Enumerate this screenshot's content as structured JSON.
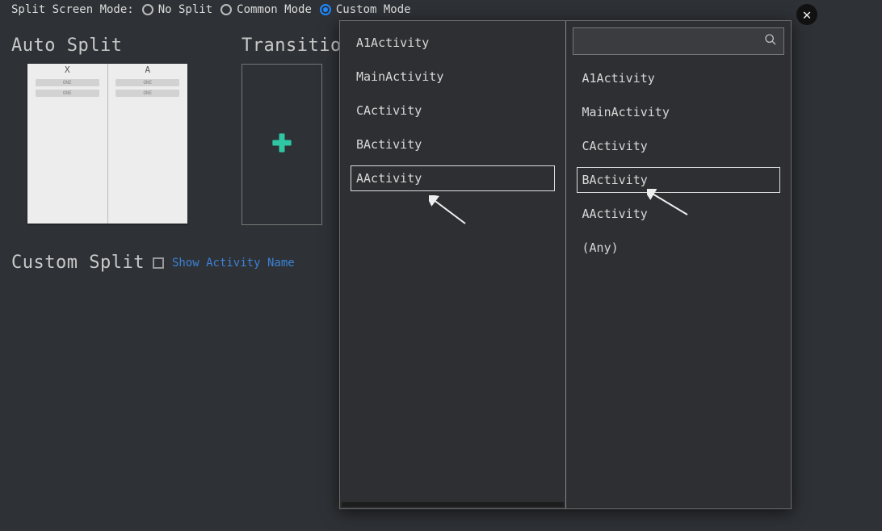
{
  "mode": {
    "label": "Split Screen Mode:",
    "options": {
      "no_split": "No Split",
      "common": "Common Mode",
      "custom": "Custom Mode"
    },
    "selected": "custom"
  },
  "sections": {
    "auto_split": "Auto Split",
    "transition": "Transition",
    "custom_split": "Custom Split"
  },
  "autosplit_preview": {
    "left_header": "X",
    "right_header": "A",
    "bar_label": "ONE"
  },
  "custom_row": {
    "show_activity": "Show Activity Name"
  },
  "modal": {
    "left": {
      "items": [
        "A1Activity",
        "MainActivity",
        "CActivity",
        "BActivity",
        "AActivity"
      ],
      "selected_index": 4
    },
    "right": {
      "search_placeholder": "",
      "items": [
        "A1Activity",
        "MainActivity",
        "CActivity",
        "BActivity",
        "AActivity",
        "(Any)"
      ],
      "selected_index": 3
    }
  },
  "icons": {
    "close": "✕",
    "search": "⌕",
    "plus": "＋"
  }
}
